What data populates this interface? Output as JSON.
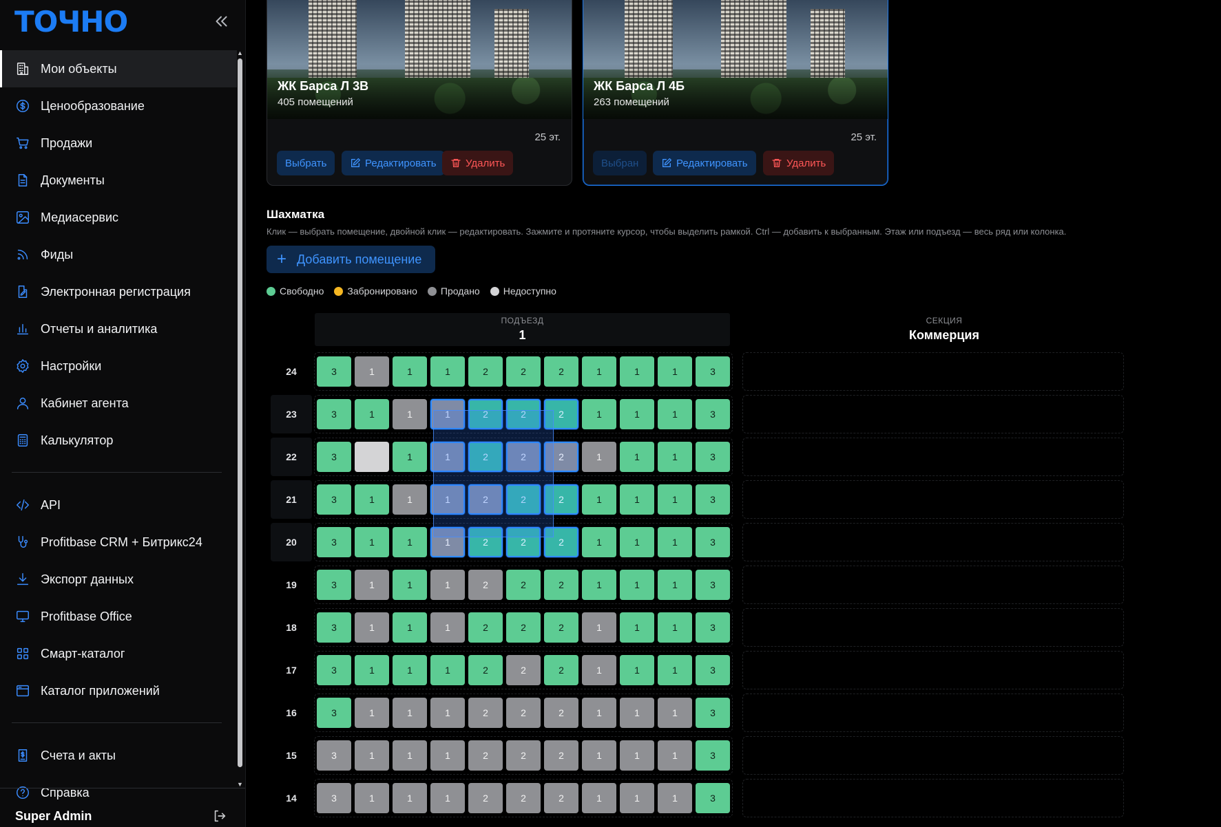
{
  "brand": {
    "logo": "ТОЧНО"
  },
  "sidebar": {
    "nav": [
      {
        "label": "Мои объекты",
        "icon": "building-icon",
        "active": true
      },
      {
        "label": "Ценообразование",
        "icon": "dollar-circle-icon"
      },
      {
        "label": "Продажи",
        "icon": "cart-icon"
      },
      {
        "label": "Документы",
        "icon": "document-icon"
      },
      {
        "label": "Медиасервис",
        "icon": "image-icon"
      },
      {
        "label": "Фиды",
        "icon": "rss-icon"
      },
      {
        "label": "Электронная регистрация",
        "icon": "edit-document-icon"
      },
      {
        "label": "Отчеты и аналитика",
        "icon": "bar-chart-icon"
      },
      {
        "label": "Настройки",
        "icon": "gear-icon"
      },
      {
        "label": "Кабинет агента",
        "icon": "user-icon"
      },
      {
        "label": "Калькулятор",
        "icon": "calculator-icon"
      }
    ],
    "nav2": [
      {
        "label": "API",
        "icon": "code-icon"
      },
      {
        "label": "Profitbase CRM + Битрикс24",
        "icon": "integration-icon"
      },
      {
        "label": "Экспорт данных",
        "icon": "download-icon"
      },
      {
        "label": "Profitbase Office",
        "icon": "monitor-icon"
      },
      {
        "label": "Смарт-каталог",
        "icon": "grid-icon"
      },
      {
        "label": "Каталог приложений",
        "icon": "window-icon"
      }
    ],
    "nav3": [
      {
        "label": "Счета и акты",
        "icon": "invoice-icon"
      },
      {
        "label": "Справка",
        "icon": "help-icon"
      }
    ],
    "user": "Super Admin"
  },
  "projects": [
    {
      "title": "ЖК Барса Л 3В",
      "rooms": "405 помещений",
      "floors": "25 эт.",
      "select_label": "Выбрать",
      "edit_label": "Редактировать",
      "delete_label": "Удалить",
      "selected": false
    },
    {
      "title": "ЖК Барса Л 4Б",
      "rooms": "263 помещений",
      "floors": "25 эт.",
      "select_label": "Выбран",
      "edit_label": "Редактировать",
      "delete_label": "Удалить",
      "selected": true
    }
  ],
  "board": {
    "title": "Шахматка",
    "hint": "Клик — выбрать помещение, двойной клик — редактировать. Зажмите и протяните курсор, чтобы выделить рамкой. Ctrl — добавить к выбранным. Этаж или подъезд — весь ряд или колонка.",
    "add_label": "Добавить помещение",
    "legend": [
      {
        "label": "Свободно",
        "color": "#5dcc93"
      },
      {
        "label": "Забронировано",
        "color": "#f5b722"
      },
      {
        "label": "Продано",
        "color": "#8f9094"
      },
      {
        "label": "Недоступно",
        "color": "#d4d4d6"
      }
    ],
    "entrance": {
      "caption": "ПОДЪЕЗД",
      "value": "1"
    },
    "section": {
      "caption": "СЕКЦИЯ",
      "value": "Коммерция"
    },
    "rows": [
      {
        "floor": "24",
        "cells": [
          [
            "3",
            "free"
          ],
          [
            "1",
            "sold"
          ],
          [
            "1",
            "free"
          ],
          [
            "1",
            "free"
          ],
          [
            "2",
            "free"
          ],
          [
            "2",
            "free"
          ],
          [
            "2",
            "free"
          ],
          [
            "1",
            "free"
          ],
          [
            "1",
            "free"
          ],
          [
            "1",
            "free"
          ],
          [
            "3",
            "free"
          ]
        ]
      },
      {
        "floor": "23",
        "cells": [
          [
            "3",
            "free"
          ],
          [
            "1",
            "free"
          ],
          [
            "1",
            "sold"
          ],
          [
            "1",
            "sold",
            "sel"
          ],
          [
            "2",
            "free",
            "sel"
          ],
          [
            "2",
            "free",
            "sel"
          ],
          [
            "2",
            "free",
            "sel"
          ],
          [
            "1",
            "free"
          ],
          [
            "1",
            "free"
          ],
          [
            "1",
            "free"
          ],
          [
            "3",
            "free"
          ]
        ]
      },
      {
        "floor": "22",
        "cells": [
          [
            "3",
            "free"
          ],
          [
            "",
            "na"
          ],
          [
            "1",
            "free"
          ],
          [
            "1",
            "sold",
            "sel"
          ],
          [
            "2",
            "free",
            "sel"
          ],
          [
            "2",
            "sold",
            "sel"
          ],
          [
            "2",
            "sold",
            "sel"
          ],
          [
            "1",
            "sold"
          ],
          [
            "1",
            "free"
          ],
          [
            "1",
            "free"
          ],
          [
            "3",
            "free"
          ]
        ]
      },
      {
        "floor": "21",
        "cells": [
          [
            "3",
            "free"
          ],
          [
            "1",
            "free"
          ],
          [
            "1",
            "sold"
          ],
          [
            "1",
            "sold",
            "sel"
          ],
          [
            "2",
            "sold",
            "sel"
          ],
          [
            "2",
            "free",
            "sel"
          ],
          [
            "2",
            "free",
            "sel"
          ],
          [
            "1",
            "free"
          ],
          [
            "1",
            "free"
          ],
          [
            "1",
            "free"
          ],
          [
            "3",
            "free"
          ]
        ]
      },
      {
        "floor": "20",
        "cells": [
          [
            "3",
            "free"
          ],
          [
            "1",
            "free"
          ],
          [
            "1",
            "free"
          ],
          [
            "1",
            "sold",
            "sel"
          ],
          [
            "2",
            "free",
            "sel"
          ],
          [
            "2",
            "free",
            "sel"
          ],
          [
            "2",
            "free",
            "sel"
          ],
          [
            "1",
            "free"
          ],
          [
            "1",
            "free"
          ],
          [
            "1",
            "free"
          ],
          [
            "3",
            "free"
          ]
        ]
      },
      {
        "floor": "19",
        "cells": [
          [
            "3",
            "free"
          ],
          [
            "1",
            "sold"
          ],
          [
            "1",
            "free"
          ],
          [
            "1",
            "sold"
          ],
          [
            "2",
            "sold"
          ],
          [
            "2",
            "free"
          ],
          [
            "2",
            "free"
          ],
          [
            "1",
            "free"
          ],
          [
            "1",
            "free"
          ],
          [
            "1",
            "free"
          ],
          [
            "3",
            "free"
          ]
        ]
      },
      {
        "floor": "18",
        "cells": [
          [
            "3",
            "free"
          ],
          [
            "1",
            "sold"
          ],
          [
            "1",
            "free"
          ],
          [
            "1",
            "sold"
          ],
          [
            "2",
            "free"
          ],
          [
            "2",
            "free"
          ],
          [
            "2",
            "free"
          ],
          [
            "1",
            "sold"
          ],
          [
            "1",
            "free"
          ],
          [
            "1",
            "free"
          ],
          [
            "3",
            "free"
          ]
        ]
      },
      {
        "floor": "17",
        "cells": [
          [
            "3",
            "free"
          ],
          [
            "1",
            "free"
          ],
          [
            "1",
            "free"
          ],
          [
            "1",
            "free"
          ],
          [
            "2",
            "free"
          ],
          [
            "2",
            "sold"
          ],
          [
            "2",
            "free"
          ],
          [
            "1",
            "sold"
          ],
          [
            "1",
            "free"
          ],
          [
            "1",
            "free"
          ],
          [
            "3",
            "free"
          ]
        ]
      },
      {
        "floor": "16",
        "cells": [
          [
            "3",
            "free"
          ],
          [
            "1",
            "sold"
          ],
          [
            "1",
            "sold"
          ],
          [
            "1",
            "sold"
          ],
          [
            "2",
            "sold"
          ],
          [
            "2",
            "sold"
          ],
          [
            "2",
            "sold"
          ],
          [
            "1",
            "sold"
          ],
          [
            "1",
            "sold"
          ],
          [
            "1",
            "sold"
          ],
          [
            "3",
            "free"
          ]
        ]
      },
      {
        "floor": "15",
        "cells": [
          [
            "3",
            "sold"
          ],
          [
            "1",
            "sold"
          ],
          [
            "1",
            "sold"
          ],
          [
            "1",
            "sold"
          ],
          [
            "2",
            "sold"
          ],
          [
            "2",
            "sold"
          ],
          [
            "2",
            "sold"
          ],
          [
            "1",
            "sold"
          ],
          [
            "1",
            "sold"
          ],
          [
            "1",
            "sold"
          ],
          [
            "3",
            "free"
          ]
        ]
      },
      {
        "floor": "14",
        "cells": [
          [
            "3",
            "sold"
          ],
          [
            "1",
            "sold"
          ],
          [
            "1",
            "sold"
          ],
          [
            "1",
            "sold"
          ],
          [
            "2",
            "sold"
          ],
          [
            "2",
            "sold"
          ],
          [
            "2",
            "sold"
          ],
          [
            "1",
            "sold"
          ],
          [
            "1",
            "sold"
          ],
          [
            "1",
            "sold"
          ],
          [
            "3",
            "free"
          ]
        ]
      }
    ]
  }
}
